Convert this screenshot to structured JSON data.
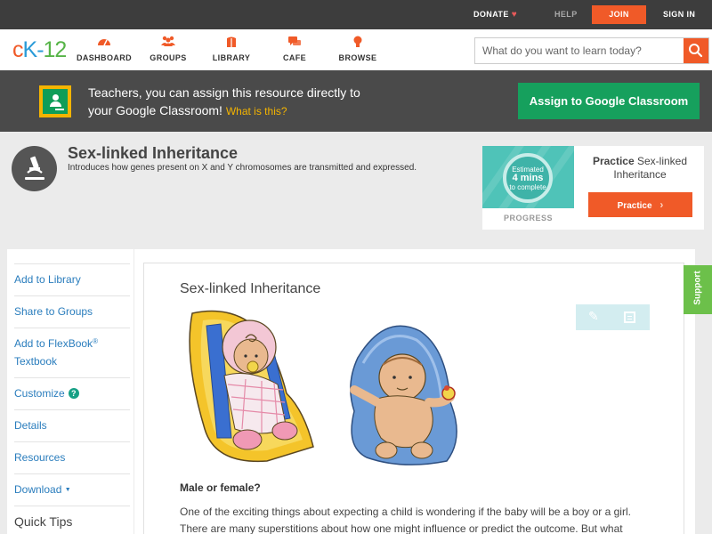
{
  "topbar": {
    "donate": "DONATE",
    "help": "HELP",
    "join": "JOIN",
    "signin": "SIGN IN"
  },
  "logo": {
    "c": "c",
    "k": "K",
    "dash": "-",
    "n": "12"
  },
  "nav": {
    "dashboard": "DASHBOARD",
    "groups": "GROUPS",
    "library": "LIBRARY",
    "cafe": "CAFE",
    "browse": "BROWSE"
  },
  "search": {
    "placeholder": "What do you want to learn today?"
  },
  "banner": {
    "line1": "Teachers, you can assign this resource directly to",
    "line2": "your Google Classroom!",
    "whatis": "What is this?",
    "assign": "Assign to Google Classroom"
  },
  "lesson": {
    "title": "Sex-linked Inheritance",
    "description": "Introduces how genes present on X and Y chromosomes are transmitted and expressed."
  },
  "practice_card": {
    "estimated": "Estimated",
    "mins": "4 mins",
    "complete": "to complete",
    "progress": "PROGRESS",
    "practice_word": "Practice",
    "practice_topic": "Sex-linked Inheritance",
    "button": "Practice"
  },
  "sidebar": {
    "add_library": "Add to Library",
    "share_groups": "Share to Groups",
    "add_flexbook_1": "Add to FlexBook",
    "add_flexbook_sup": "®",
    "add_flexbook_2": "Textbook",
    "customize": "Customize",
    "customize_help": "?",
    "details": "Details",
    "resources": "Resources",
    "download": "Download",
    "download_caret": "▼",
    "quick_tips": "Quick Tips"
  },
  "content": {
    "title": "Sex-linked Inheritance",
    "subhead": "Male or female?",
    "paragraph": "One of the exciting things about expecting a child is wondering if the baby will be a boy or a girl. There are many superstitions about how one might influence or predict the outcome. But what"
  },
  "support": "Support",
  "colors": {
    "accent": "#f05a28",
    "google_green": "#16a05d",
    "link": "#2a7dbd",
    "support": "#6cc04a"
  }
}
